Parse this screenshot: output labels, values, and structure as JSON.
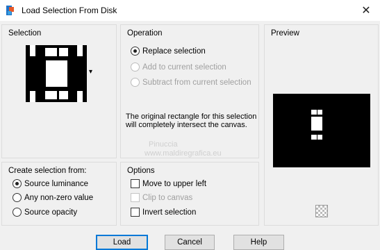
{
  "window": {
    "title": "Load Selection From Disk",
    "close_glyph": "✕"
  },
  "selection_panel": {
    "title": "Selection",
    "dropdown_glyph": "▾"
  },
  "operation_panel": {
    "title": "Operation",
    "options": [
      {
        "label": "Replace selection",
        "selected": true,
        "enabled": true
      },
      {
        "label": "Add to current selection",
        "selected": false,
        "enabled": false
      },
      {
        "label": "Subtract from current selection",
        "selected": false,
        "enabled": false
      }
    ],
    "description": "The original rectangle for this selection will completely intersect the canvas."
  },
  "preview_panel": {
    "title": "Preview"
  },
  "create_from_panel": {
    "title": "Create selection from:",
    "options": [
      {
        "label": "Source luminance",
        "selected": true
      },
      {
        "label": "Any non-zero value",
        "selected": false
      },
      {
        "label": "Source opacity",
        "selected": false
      }
    ]
  },
  "options_panel": {
    "title": "Options",
    "items": [
      {
        "label": "Move to upper left",
        "checked": false,
        "enabled": true
      },
      {
        "label": "Clip to canvas",
        "checked": false,
        "enabled": false
      },
      {
        "label": "Invert selection",
        "checked": false,
        "enabled": true
      }
    ]
  },
  "watermark": {
    "line1": "Pinuccia",
    "line2": "www.maldiregrafica.eu"
  },
  "buttons": {
    "load": "Load",
    "cancel": "Cancel",
    "help": "Help"
  },
  "icons": {
    "app": "paint-shop-icon",
    "close": "close-icon",
    "dropdown": "dropdown-arrow-icon",
    "navigate": "navigate-icon"
  }
}
